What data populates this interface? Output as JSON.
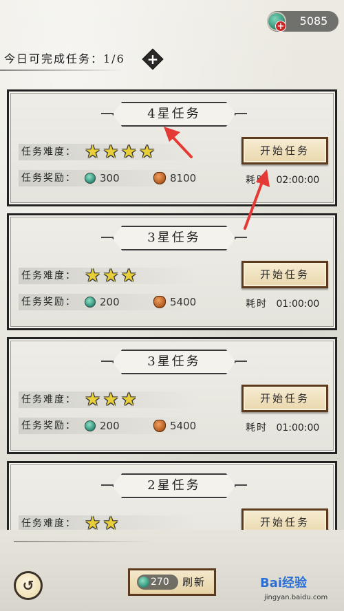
{
  "currency": {
    "icon": "jade-coin-icon",
    "value": "5085",
    "plus": "+"
  },
  "daily": {
    "label": "今日可完成任务：1/6",
    "add": "+"
  },
  "tasks": [
    {
      "title": "4星任务",
      "difficulty_label": "任务难度：",
      "stars": 4,
      "reward_label": "任务奖励：",
      "jade": "300",
      "copper": "8100",
      "button": "开始任务",
      "time_label": "耗时",
      "time": "02:00:00"
    },
    {
      "title": "3星任务",
      "difficulty_label": "任务难度：",
      "stars": 3,
      "reward_label": "任务奖励：",
      "jade": "200",
      "copper": "5400",
      "button": "开始任务",
      "time_label": "耗时",
      "time": "01:00:00"
    },
    {
      "title": "3星任务",
      "difficulty_label": "任务难度：",
      "stars": 3,
      "reward_label": "任务奖励：",
      "jade": "200",
      "copper": "5400",
      "button": "开始任务",
      "time_label": "耗时",
      "time": "01:00:00"
    },
    {
      "title": "2星任务",
      "difficulty_label": "任务难度：",
      "stars": 2,
      "reward_label": "任务奖励：",
      "jade": "",
      "copper": "",
      "button": "开始任务",
      "time_label": "",
      "time": ""
    }
  ],
  "bottom": {
    "back_icon": "back-arrow-icon",
    "refresh_cost": "270",
    "refresh_label": "刷新"
  },
  "watermark": {
    "brand": "Bai经验",
    "sub": "jingyan.baidu.com"
  },
  "colors": {
    "arrow": "#e53935",
    "star": "#e8cf3a",
    "button_border": "#5b3a1e"
  }
}
